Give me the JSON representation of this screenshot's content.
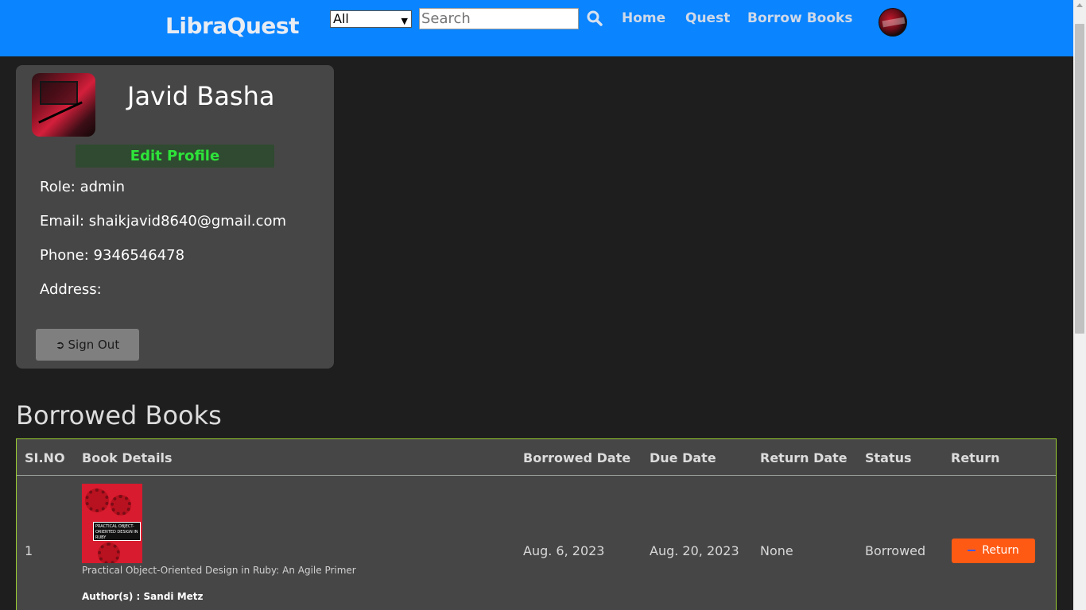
{
  "header": {
    "brand": "LibraQuest",
    "category_select": {
      "selected": "All"
    },
    "search": {
      "placeholder": "Search"
    },
    "nav": [
      {
        "label": "Home"
      },
      {
        "label": "Quest"
      },
      {
        "label": "Borrow Books"
      }
    ]
  },
  "profile": {
    "name": "Javid Basha",
    "edit_label": "Edit Profile",
    "role": "Role: admin",
    "email": "Email: shaikjavid8640@gmail.com",
    "phone": "Phone: 9346546478",
    "address": "Address:",
    "signout_label": "Sign Out"
  },
  "borrowed": {
    "title": "Borrowed Books",
    "columns": [
      "SI.NO",
      "Book Details",
      "Borrowed Date",
      "Due Date",
      "Return Date",
      "Status",
      "Return"
    ],
    "rows": [
      {
        "sino": "1",
        "book_title": "Practical Object-Oriented Design in Ruby: An Agile Primer",
        "authors": "Author(s) : Sandi Metz",
        "cover_text": "PRACTICAL OBJECT-ORIENTED DESIGN IN RUBY",
        "borrowed_date": "Aug. 6, 2023",
        "due_date": "Aug. 20, 2023",
        "return_date": "None",
        "status": "Borrowed",
        "return_label": "Return"
      }
    ]
  },
  "colors": {
    "header_bg": "#0a84ff",
    "page_bg": "#1e1e1e",
    "card_bg": "#474646",
    "edit_text": "#2ee33a",
    "return_btn": "#ff5a14",
    "table_border": "#9acd32"
  }
}
